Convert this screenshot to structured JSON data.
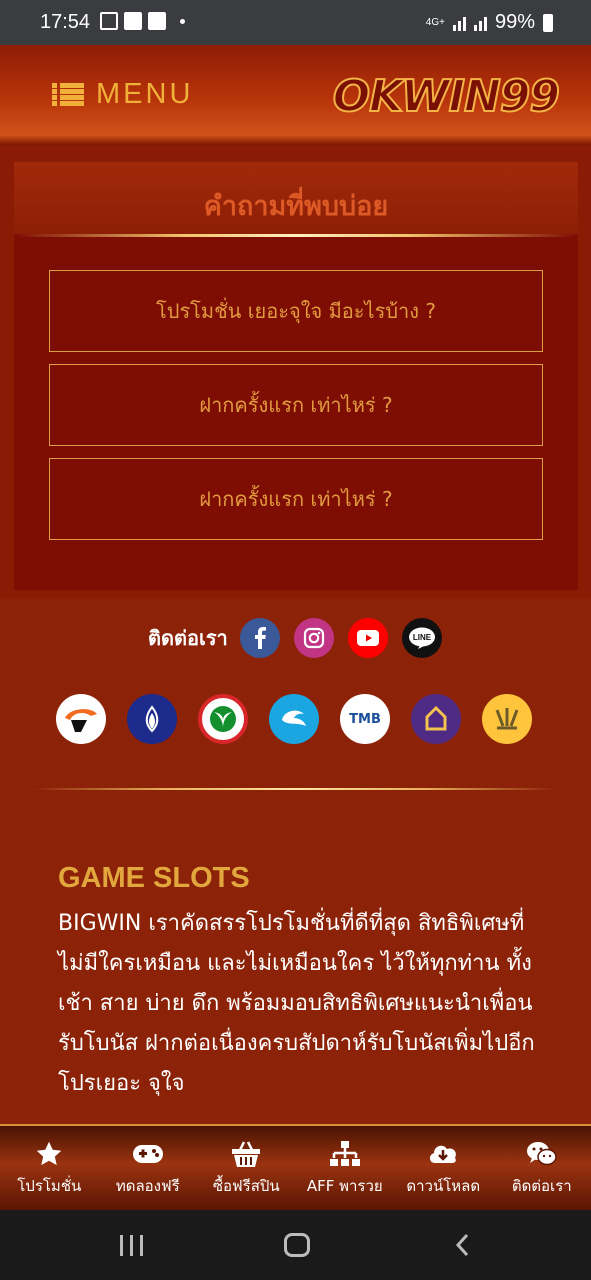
{
  "status_bar": {
    "time": "17:54",
    "network": "4G+",
    "battery": "99%"
  },
  "header": {
    "menu_label": "MENU",
    "logo_text": "OKWIN99"
  },
  "faq": {
    "title": "คำถามที่พบบ่อย",
    "items": [
      "โปรโมชั่น เยอะจุใจ มีอะไรบ้าง ?",
      "ฝากครั้งแรก เท่าไหร่ ?",
      "ฝากครั้งแรก เท่าไหร่ ?"
    ]
  },
  "contact": {
    "label": "ติดต่อเรา",
    "social": [
      {
        "name": "facebook-icon",
        "color": "#3b5998"
      },
      {
        "name": "instagram-icon",
        "color": "#c13584"
      },
      {
        "name": "youtube-icon",
        "color": "#ff0000"
      },
      {
        "name": "line-icon",
        "color": "#111111",
        "text": "LINE"
      }
    ],
    "banks": [
      {
        "name": "bank-thanachart-icon",
        "color": "#ffffff"
      },
      {
        "name": "bank-bualuang-icon",
        "color": "#1c2b8c"
      },
      {
        "name": "bank-kasikorn-icon",
        "color": "#ffffff"
      },
      {
        "name": "bank-krungthai-icon",
        "color": "#1ba5e1"
      },
      {
        "name": "bank-tmb-icon",
        "color": "#ffffff",
        "text": "TMB"
      },
      {
        "name": "bank-scb-icon",
        "color": "#4e2a84"
      },
      {
        "name": "bank-krungsri-icon",
        "color": "#fec43b"
      }
    ]
  },
  "content": {
    "title": "GAME SLOTS",
    "body": "BIGWIN เราคัดสรรโปรโมชั่นที่ดีที่สุด สิทธิพิเศษที่ไม่มีใครเหมือน และไม่เหมือนใคร ไว้ให้ทุกท่าน ทั้ง เช้า สาย บ่าย ดึก พร้อมมอบสิทธิพิเศษแนะนำเพื่อนรับโบนัส ฝากต่อเนื่องครบสัปดาห์รับโบนัสเพิ่มไปอีก โปรเยอะ จุใจ"
  },
  "bottom_nav": [
    {
      "label": "โปรโมชั่น",
      "icon": "star-icon"
    },
    {
      "label": "ทดลองฟรี",
      "icon": "gamepad-icon"
    },
    {
      "label": "ซื้อฟรีสปิน",
      "icon": "basket-icon"
    },
    {
      "label": "AFF พารวย",
      "icon": "sitemap-icon"
    },
    {
      "label": "ดาวน์โหลด",
      "icon": "cloud-download-icon"
    },
    {
      "label": "ติดต่อเรา",
      "icon": "wechat-icon"
    }
  ],
  "colors": {
    "gold": "#e2a73d",
    "bg": "#8c2208",
    "faq_bg": "#7e0e04"
  }
}
